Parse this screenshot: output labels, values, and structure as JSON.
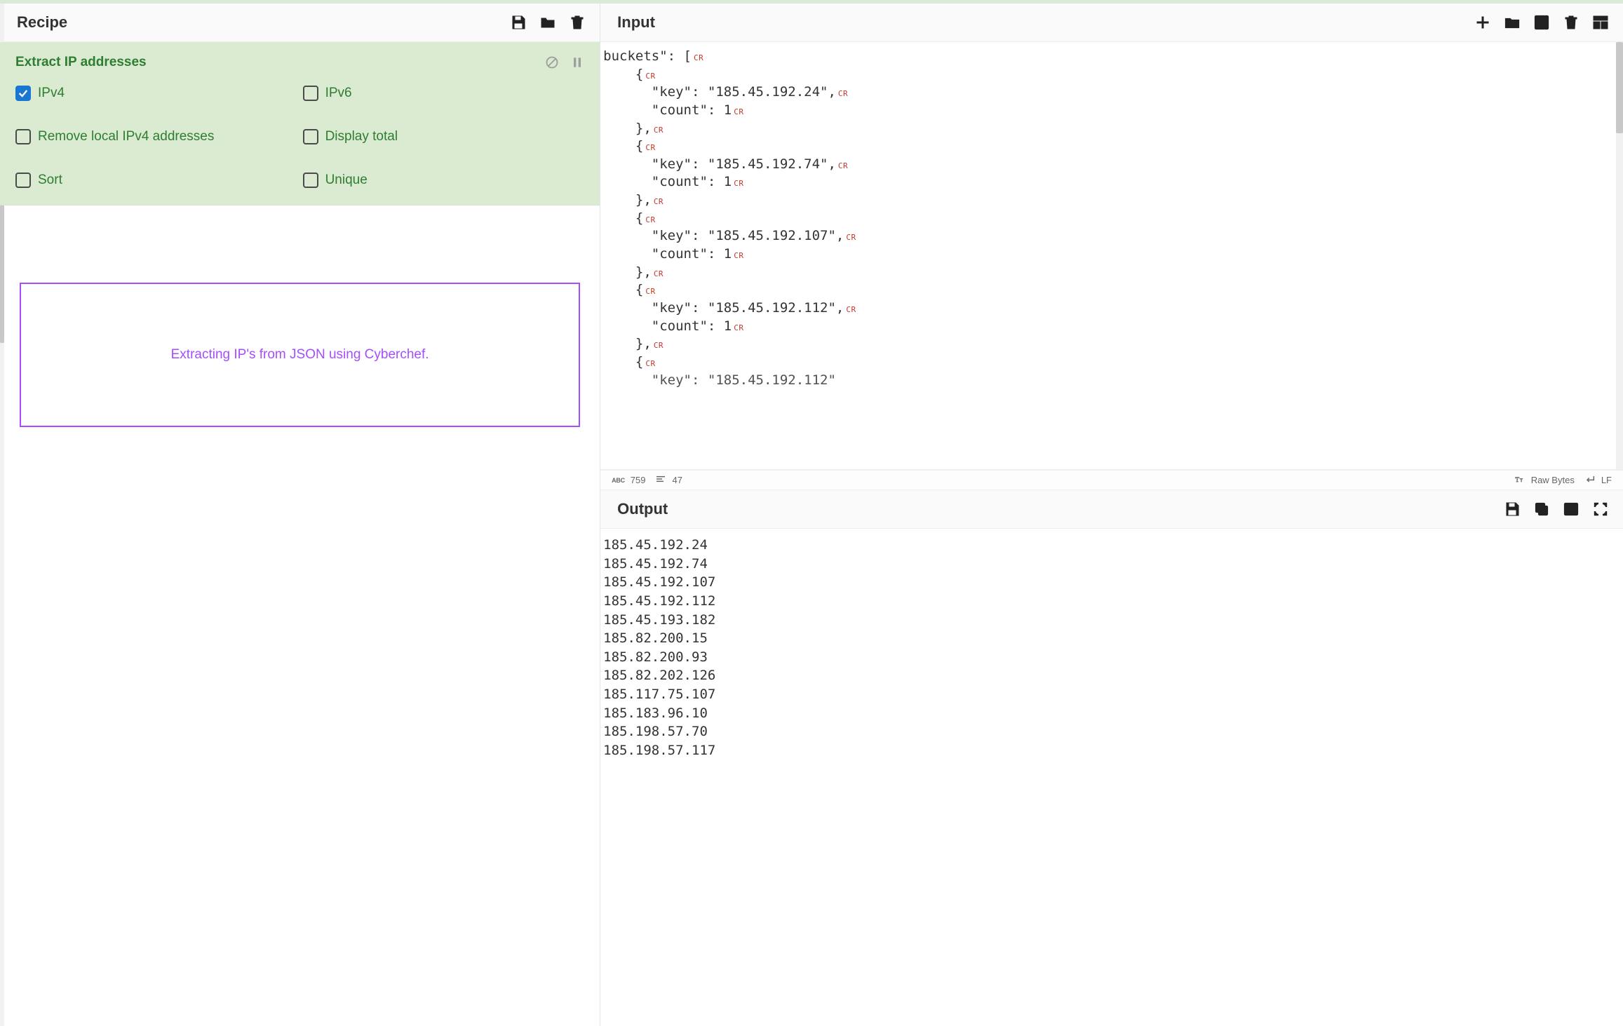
{
  "recipe": {
    "title": "Recipe",
    "operation": {
      "name": "Extract IP addresses",
      "options": {
        "ipv4": {
          "label": "IPv4",
          "checked": true
        },
        "ipv6": {
          "label": "IPv6",
          "checked": false
        },
        "remove_local": {
          "label": "Remove local IPv4 addresses",
          "checked": false
        },
        "display_total": {
          "label": "Display total",
          "checked": false
        },
        "sort": {
          "label": "Sort",
          "checked": false
        },
        "unique": {
          "label": "Unique",
          "checked": false
        }
      }
    }
  },
  "annotation": "Extracting IP's from JSON using Cyberchef.",
  "input": {
    "title": "Input",
    "buckets": [
      {
        "key": "185.45.192.24",
        "count": 1
      },
      {
        "key": "185.45.192.74",
        "count": 1
      },
      {
        "key": "185.45.192.107",
        "count": 1
      },
      {
        "key": "185.45.192.112",
        "count": 1
      }
    ],
    "stats": {
      "chars": "759",
      "lines": "47",
      "font_label": "Raw Bytes",
      "eol": "LF"
    }
  },
  "output": {
    "title": "Output",
    "lines": [
      "185.45.192.24",
      "185.45.192.74",
      "185.45.192.107",
      "185.45.192.112",
      "185.45.193.182",
      "185.82.200.15",
      "185.82.200.93",
      "185.82.202.126",
      "185.117.75.107",
      "185.183.96.10",
      "185.198.57.70",
      "185.198.57.117"
    ]
  },
  "icons": {
    "save": "save-icon",
    "folder": "folder-icon",
    "trash": "trash-icon",
    "plus": "plus-icon",
    "open_folder": "open-folder-icon",
    "load_input": "load-input-icon",
    "trash2": "trash-icon",
    "tabs": "tabs-icon",
    "disable": "disable-icon",
    "pause": "pause-icon",
    "copy": "copy-icon",
    "upload": "upload-output-icon",
    "fullscreen": "fullscreen-icon"
  }
}
